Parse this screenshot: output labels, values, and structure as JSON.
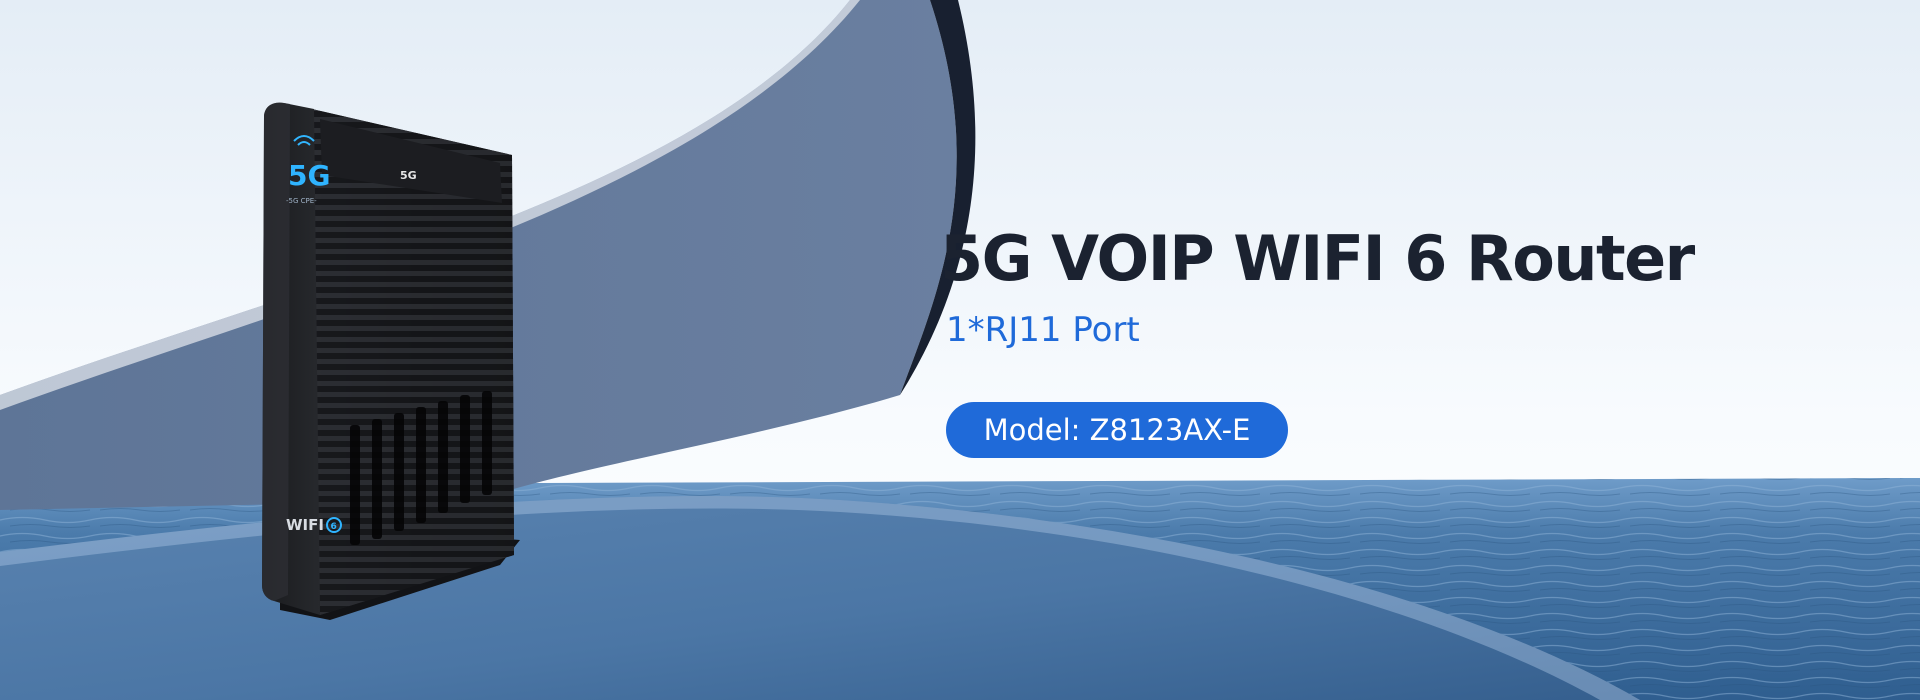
{
  "banner": {
    "title": "5G VOIP WIFI 6 Router",
    "subtitle": "1*RJ11 Port",
    "model_label": "Model: Z8123AX-E"
  },
  "product": {
    "badge_main": "5G",
    "badge_sub": "-5G CPE-",
    "top_logo": "5G",
    "wifi_label": "WIFI",
    "wifi_generation": "6"
  },
  "colors": {
    "accent": "#1f6ad9",
    "headline": "#1b2230",
    "arc": "#647a99",
    "sea": "#3e6c9b",
    "router_body": "#1c1d20"
  }
}
